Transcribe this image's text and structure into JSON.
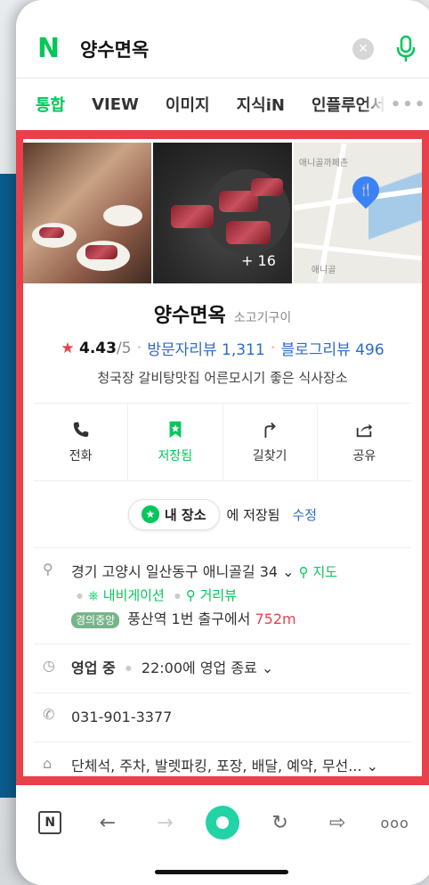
{
  "search": {
    "logo": "N",
    "query": "양수면옥",
    "clear_icon": "close-icon",
    "mic_icon": "mic-icon"
  },
  "tabs": [
    {
      "label": "통합",
      "active": true
    },
    {
      "label": "VIEW",
      "active": false
    },
    {
      "label": "이미지",
      "active": false
    },
    {
      "label": "지식iN",
      "active": false
    },
    {
      "label": "인플루언서",
      "active": false
    }
  ],
  "tabs_more": "•••",
  "photos": {
    "count_label": "+ 16",
    "map_labels": [
      "애니골까페촌",
      "애니골"
    ]
  },
  "place": {
    "name": "양수면옥",
    "category": "소고기구이",
    "rating": "4.43",
    "rating_max": "/5",
    "visitor_reviews": "방문자리뷰 1,311",
    "blog_reviews": "블로그리뷰 496",
    "description": "청국장 갈비탕맛집 어른모시기 좋은 식사장소"
  },
  "actions": [
    {
      "label": "전화",
      "icon": "phone-icon"
    },
    {
      "label": "저장됨",
      "icon": "bookmark-star-icon"
    },
    {
      "label": "길찾기",
      "icon": "directions-icon"
    },
    {
      "label": "공유",
      "icon": "share-icon"
    }
  ],
  "saved": {
    "pill_label": "내 장소",
    "saved_text": "에 저장됨",
    "edit_label": "수정"
  },
  "info": {
    "address": "경기 고양시 일산동구 애니골길 34",
    "map_link": "지도",
    "navigation_link": "내비게이션",
    "street_view_link": "거리뷰",
    "subway_line": "경의중앙",
    "station": "풍산역",
    "exit_text": "1번 출구에서",
    "distance": "752m",
    "status": "영업 중",
    "hours": "22:00에 영업 종료",
    "phone": "031-901-3377",
    "amenities": "단체석, 주차, 발렛파킹, 포장, 배달, 예약, 무선..."
  },
  "colors": {
    "brand_green": "#03c75a",
    "highlight_red": "#e8414a",
    "link_blue": "#2d6cc5"
  }
}
